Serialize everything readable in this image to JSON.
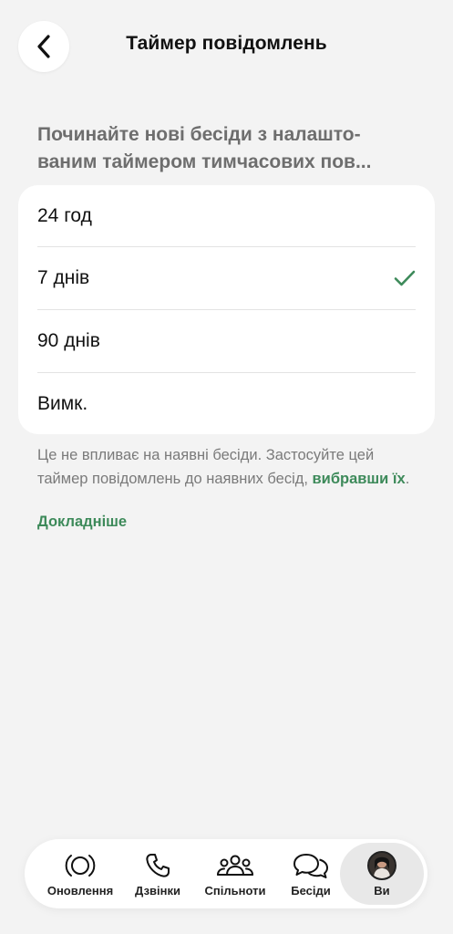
{
  "header": {
    "title": "Таймер повідомлень"
  },
  "description": "Починайте нові бесіди з налашто-ваним таймером тимчасових пов...",
  "options": [
    {
      "label": "24 год",
      "selected": false
    },
    {
      "label": "7 днів",
      "selected": true
    },
    {
      "label": "90 днів",
      "selected": false
    },
    {
      "label": "Вимк.",
      "selected": false
    }
  ],
  "note": {
    "text": "Це не впливає на наявні бесіди. Застосуйте цей таймер повідомлень до наявних бесід, ",
    "link": "вибравши їх",
    "end": "."
  },
  "learn_more": "Докладніше",
  "tabs": [
    {
      "label": "Оновлення",
      "icon": "updates-icon"
    },
    {
      "label": "Дзвінки",
      "icon": "phone-icon"
    },
    {
      "label": "Спільноти",
      "icon": "communities-icon"
    },
    {
      "label": "Бесіди",
      "icon": "chats-icon"
    },
    {
      "label": "Ви",
      "icon": "avatar"
    }
  ],
  "colors": {
    "accent": "#3d8a5a",
    "background": "#f3f3f3",
    "card": "#ffffff"
  }
}
